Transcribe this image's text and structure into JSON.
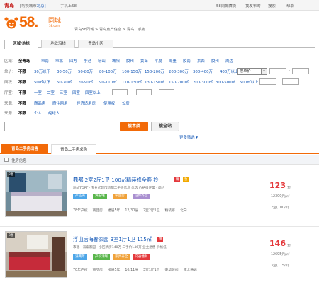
{
  "topbar": {
    "city": "青岛",
    "switch": "[切换城市",
    "switch_link": "北京]",
    "mobile": "手机上58",
    "links": [
      "58同城首页",
      "我发布的",
      "搜索",
      "帮助"
    ]
  },
  "logo": {
    "brand": "58.",
    "tongcheng": "同城",
    "url": "58.com"
  },
  "breadcrumb": "青岛58同城 > 青岛房产信息 > 青岛二手房",
  "filter_tabs": [
    "区域/地标",
    "地铁沿线",
    "青岛小区"
  ],
  "filters": {
    "region": {
      "label": "区域：",
      "all": "全青岛",
      "items": [
        "市南",
        "市北",
        "四方",
        "李沧",
        "崂山",
        "城阳",
        "胶州",
        "黄岛",
        "平度",
        "即墨",
        "胶南",
        "莱西",
        "胶州",
        "周边"
      ]
    },
    "price": {
      "label": "单价：",
      "all": "不限",
      "items": [
        "30万以下",
        "30-50万",
        "50-80万",
        "80-100万",
        "100-150万",
        "150-200万",
        "200-300万",
        "300-400万",
        "400万以上"
      ],
      "select": "按单价"
    },
    "area": {
      "label": "面积：",
      "all": "不限",
      "items": [
        "50㎡以下",
        "50-70㎡",
        "70-90㎡",
        "90-110㎡",
        "110-130㎡",
        "130-150㎡",
        "150-200㎡",
        "200-300㎡",
        "300-500㎡",
        "500㎡以上"
      ]
    },
    "rooms": {
      "label": "厅室：",
      "all": "不限",
      "items": [
        "一室",
        "二室",
        "三室",
        "四室",
        "四室以上"
      ]
    },
    "source": {
      "label": "来源：",
      "all": "不限",
      "items": [
        "商品房",
        "商住两用",
        "经济适用房",
        "使用权",
        "公房"
      ]
    },
    "seller": {
      "label": "来源：",
      "all": "不限",
      "items": [
        "个人",
        "经纪人"
      ]
    }
  },
  "search": {
    "button": "搜本类",
    "publish": "搜全站",
    "placeholder": ""
  },
  "more_filters": "更多筛选 ▾",
  "list_tabs": [
    "青岛二手房出售",
    "青岛二手房求购"
  ],
  "toolbar": {
    "label": "住房信息"
  },
  "listings": [
    {
      "badge": "8图",
      "title": "鼎都 2室2厅1卫 100㎡精装修全套 拎",
      "tags": [
        "精",
        "急"
      ],
      "desc": "地址TOPT · 专业代理市新都二手房信息 优选 价格很正常 · 简约",
      "chips": [
        "产证满",
        "满五唯",
        "学区房",
        "证件齐全"
      ],
      "meta": [
        "78年产权",
        "商品房",
        "楼层5年",
        "12/30层",
        "2室2厅1卫",
        "精装修",
        "北向"
      ],
      "price": "123",
      "unit": "万",
      "unit_price": "12300元/㎡",
      "layout": "2室(100㎡)"
    },
    {
      "badge": "8图",
      "title": "浮山后海春家园 3室1厅1卫 115㎡",
      "tags": [
        "精"
      ],
      "desc": "市北 · 海泰家园 · 小区新房140万·二手价146万 业主急售 价格低",
      "chips": [
        "满两年",
        "产权清晰",
        "家具齐全",
        "交通便利"
      ],
      "meta": [
        "70年产权",
        "商品房",
        "楼层5年",
        "10/11层",
        "3室1厅1卫",
        "豪华装修",
        "南北通透"
      ],
      "price": "146",
      "unit": "万",
      "unit_price": "12695元/㎡",
      "layout": "3室(115㎡)"
    }
  ]
}
